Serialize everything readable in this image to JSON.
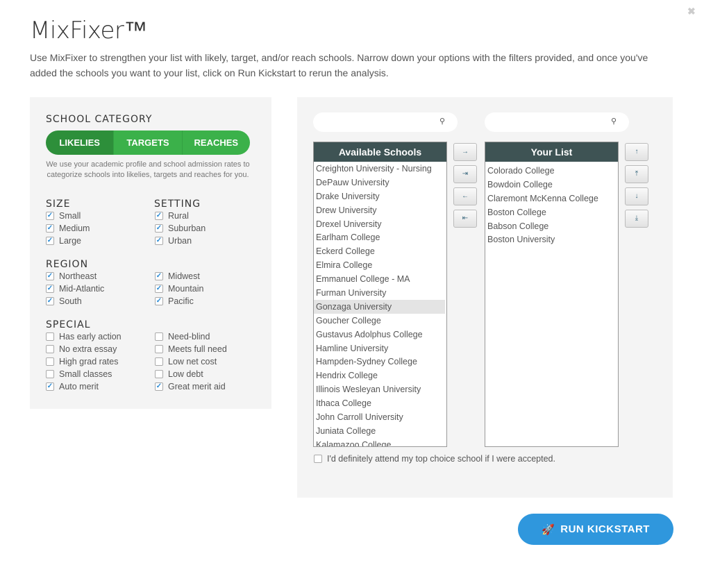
{
  "title": "MixFixer™",
  "description": "Use MixFixer to strengthen your list with likely, target, and/or reach schools. Narrow down your options with the filters provided, and once you've added the schools you want to your list, click on Run Kickstart to rerun the analysis.",
  "close_icon": "✖",
  "category": {
    "heading": "SCHOOL CATEGORY",
    "tabs": [
      "LIKELIES",
      "TARGETS",
      "REACHES"
    ],
    "active": "LIKELIES",
    "note": "We use your academic profile and school admission rates to categorize schools into likelies, targets and reaches for you."
  },
  "size": {
    "heading": "SIZE",
    "items": [
      {
        "label": "Small",
        "checked": true
      },
      {
        "label": "Medium",
        "checked": true
      },
      {
        "label": "Large",
        "checked": true
      }
    ]
  },
  "setting": {
    "heading": "SETTING",
    "items": [
      {
        "label": "Rural",
        "checked": true
      },
      {
        "label": "Suburban",
        "checked": true
      },
      {
        "label": "Urban",
        "checked": true
      }
    ]
  },
  "region": {
    "heading": "REGION",
    "items": [
      {
        "label": "Northeast",
        "checked": true
      },
      {
        "label": "Midwest",
        "checked": true
      },
      {
        "label": "Mid-Atlantic",
        "checked": true
      },
      {
        "label": "Mountain",
        "checked": true
      },
      {
        "label": "South",
        "checked": true
      },
      {
        "label": "Pacific",
        "checked": true
      }
    ]
  },
  "special": {
    "heading": "SPECIAL",
    "items": [
      {
        "label": "Has early action",
        "checked": false
      },
      {
        "label": "Need-blind",
        "checked": false
      },
      {
        "label": "No extra essay",
        "checked": false
      },
      {
        "label": "Meets full need",
        "checked": false
      },
      {
        "label": "High grad rates",
        "checked": false
      },
      {
        "label": "Low net cost",
        "checked": false
      },
      {
        "label": "Small classes",
        "checked": false
      },
      {
        "label": "Low debt",
        "checked": false
      },
      {
        "label": "Auto merit",
        "checked": true
      },
      {
        "label": "Great merit aid",
        "checked": true
      }
    ]
  },
  "available": {
    "heading": "Available Schools",
    "search_value": "",
    "selected": "Gonzaga University",
    "items": [
      "Creighton University - Nursing",
      "DePauw University",
      "Drake University",
      "Drew University",
      "Drexel University",
      "Earlham College",
      "Eckerd College",
      "Elmira College",
      "Emmanuel College - MA",
      "Furman University",
      "Gonzaga University",
      "Goucher College",
      "Gustavus Adolphus College",
      "Hamline University",
      "Hampden-Sydney College",
      "Hendrix College",
      "Illinois Wesleyan University",
      "Ithaca College",
      "John Carroll University",
      "Juniata College",
      "Kalamazoo College"
    ]
  },
  "your_list": {
    "heading": "Your List",
    "search_value": "",
    "items": [
      "Colorado College",
      "Bowdoin College",
      "Claremont McKenna College",
      "Boston College",
      "Babson College",
      "Boston University"
    ]
  },
  "move_buttons": [
    "→",
    "⇥",
    "←",
    "⇤"
  ],
  "order_buttons": [
    "↑",
    "⤒",
    "↓",
    "⤓"
  ],
  "attend": {
    "label": "I'd definitely attend my top choice school if I were accepted.",
    "checked": false
  },
  "run_button": "RUN KICKSTART",
  "colors": {
    "green": "#3bb14a",
    "green_active": "#2d8f3a",
    "header": "#3e5354",
    "blue": "#2f97dd"
  }
}
